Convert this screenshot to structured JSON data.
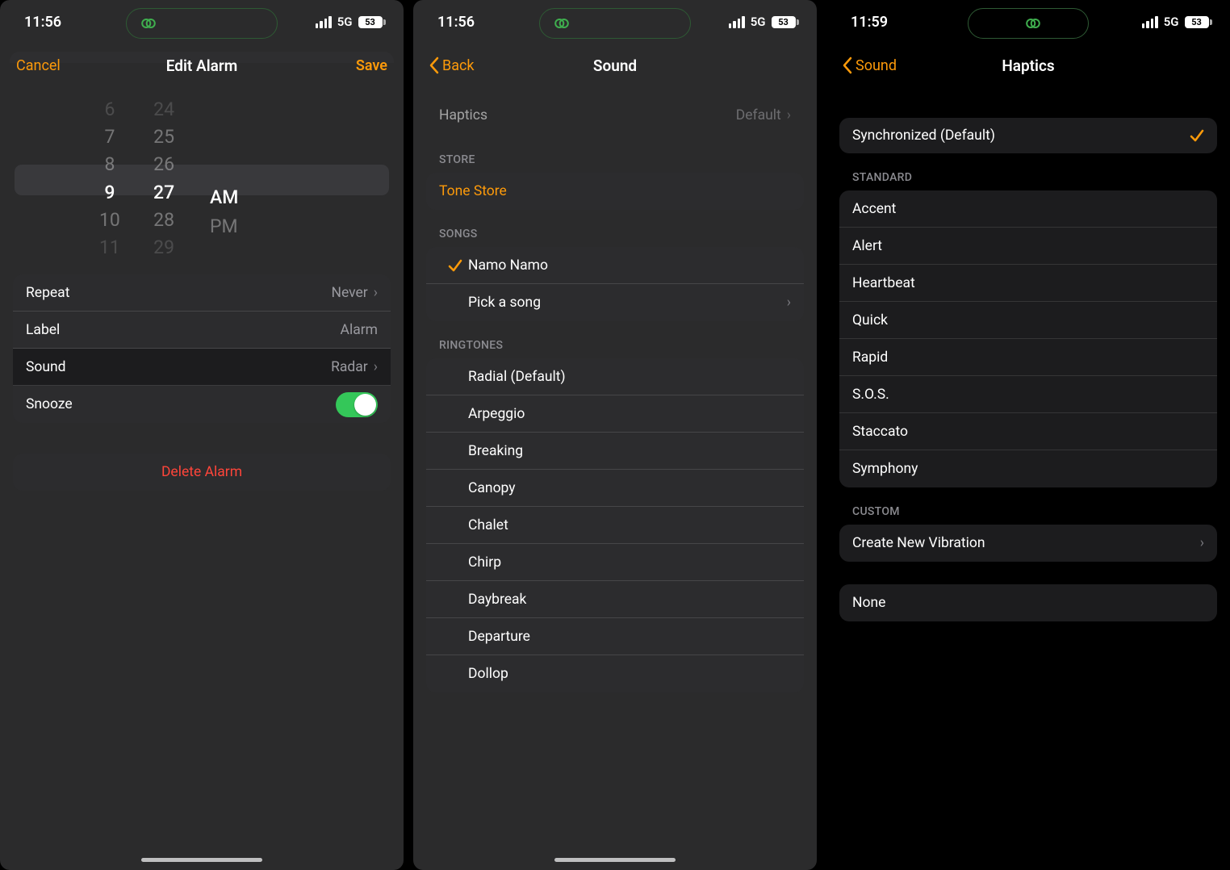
{
  "status": {
    "time1": "11:56",
    "time2": "11:56",
    "time3": "11:59",
    "network": "5G",
    "battery": "53"
  },
  "screen1": {
    "nav": {
      "cancel": "Cancel",
      "title": "Edit Alarm",
      "save": "Save"
    },
    "picker": {
      "hours": [
        "6",
        "7",
        "8",
        "9",
        "10",
        "11"
      ],
      "mins": [
        "24",
        "25",
        "26",
        "27",
        "28",
        "29"
      ],
      "ampm": [
        "AM",
        "PM"
      ]
    },
    "cells": {
      "repeat": {
        "label": "Repeat",
        "value": "Never"
      },
      "labelrow": {
        "label": "Label",
        "value": "Alarm"
      },
      "sound": {
        "label": "Sound",
        "value": "Radar"
      },
      "snooze": {
        "label": "Snooze"
      }
    },
    "delete": "Delete Alarm"
  },
  "screen2": {
    "nav": {
      "back": "Back",
      "title": "Sound"
    },
    "haptics": {
      "label": "Haptics",
      "value": "Default"
    },
    "store_header": "Store",
    "tone_store": "Tone Store",
    "songs_header": "Songs",
    "songs": {
      "selected": "Namo Namo",
      "pick": "Pick a song"
    },
    "ringtones_header": "Ringtones",
    "ringtones": [
      "Radial (Default)",
      "Arpeggio",
      "Breaking",
      "Canopy",
      "Chalet",
      "Chirp",
      "Daybreak",
      "Departure",
      "Dollop"
    ]
  },
  "screen3": {
    "nav": {
      "back": "Sound",
      "title": "Haptics"
    },
    "default_item": "Synchronized (Default)",
    "standard_header": "Standard",
    "standard": [
      "Accent",
      "Alert",
      "Heartbeat",
      "Quick",
      "Rapid",
      "S.O.S.",
      "Staccato",
      "Symphony"
    ],
    "custom_header": "Custom",
    "create": "Create New Vibration",
    "none": "None"
  }
}
